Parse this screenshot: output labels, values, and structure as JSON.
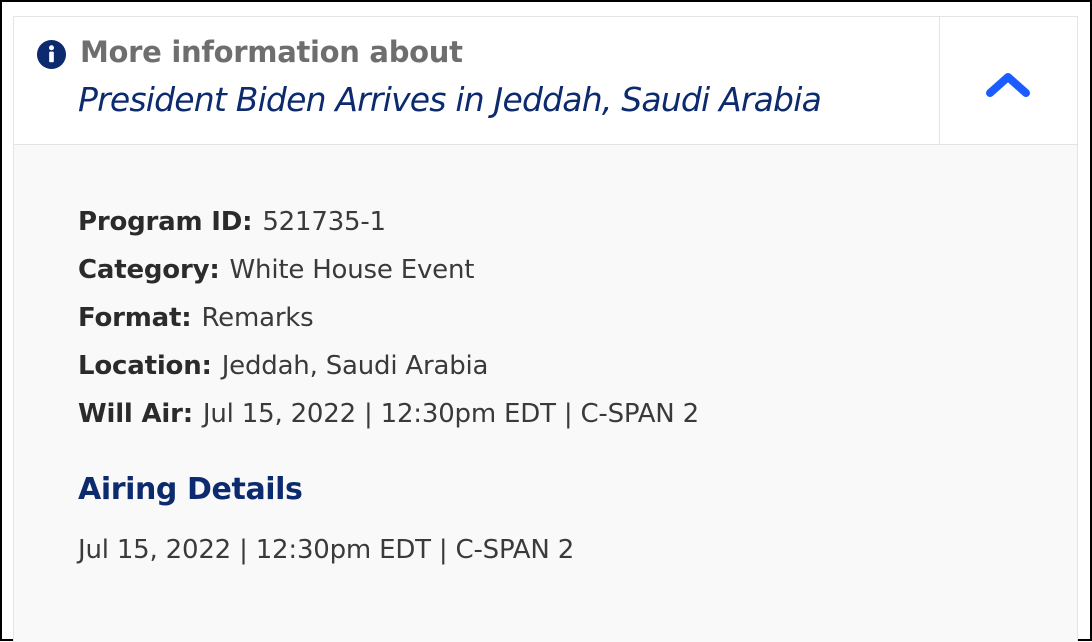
{
  "header": {
    "info_icon": "info-circle-icon",
    "heading": "More information about",
    "title": "President Biden Arrives in Jeddah, Saudi Arabia",
    "toggle_icon": "chevron-up-icon"
  },
  "details": [
    {
      "label": "Program ID:",
      "value": "521735-1"
    },
    {
      "label": "Category:",
      "value": "White House Event"
    },
    {
      "label": "Format:",
      "value": "Remarks"
    },
    {
      "label": "Location:",
      "value": "Jeddah, Saudi Arabia"
    },
    {
      "label": "Will Air:",
      "value": "Jul 15, 2022 | 12:30pm EDT | C-SPAN 2"
    }
  ],
  "airing": {
    "heading": "Airing Details",
    "text": "Jul 15, 2022 | 12:30pm EDT | C-SPAN 2"
  },
  "colors": {
    "title_navy": "#0c2a6e",
    "chevron_blue": "#1a5cff",
    "heading_gray": "#6e6e6e"
  }
}
